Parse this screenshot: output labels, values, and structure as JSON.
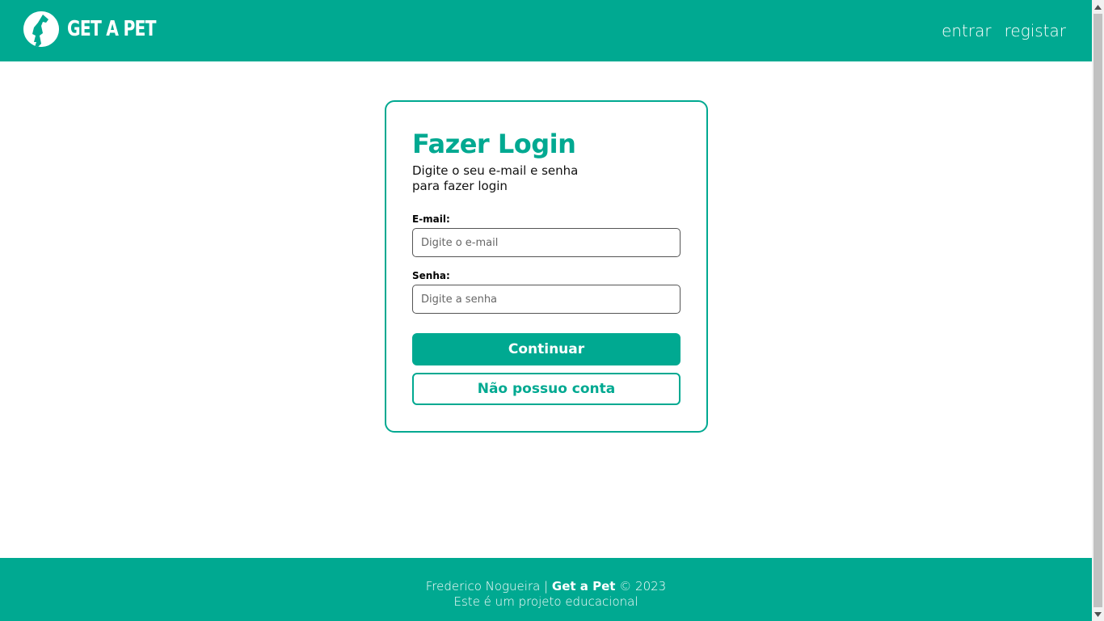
{
  "header": {
    "brand": "GET A PET",
    "nav": [
      {
        "label": "entrar"
      },
      {
        "label": "registar"
      }
    ]
  },
  "login": {
    "title": "Fazer Login",
    "subtitle": "Digite o seu e-mail e senha para fazer login",
    "email_label": "E-mail:",
    "email_placeholder": "Digite o e-mail",
    "password_label": "Senha:",
    "password_placeholder": "Digite a senha",
    "continue_label": "Continuar",
    "no_account_label": "Não possuo conta"
  },
  "footer": {
    "author": "Frederico Nogueira |",
    "brand": "Get a Pet",
    "year": "© 2023",
    "note": "Este é um projeto educacional"
  },
  "colors": {
    "accent": "#00a991",
    "background": "#ffffff"
  },
  "icons": {
    "logo": "dog-silhouette-icon",
    "scroll_up": "arrow-up-icon",
    "scroll_down": "arrow-down-icon"
  }
}
